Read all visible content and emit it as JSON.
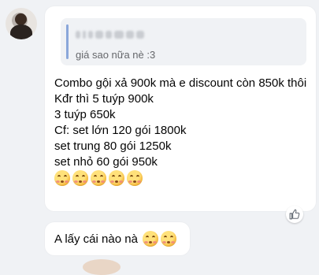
{
  "quote": {
    "text": "giá sao nữa nè :3"
  },
  "message": {
    "lines": [
      "Combo gội xả 900k mà e discount còn 850k thôi",
      "Kđr thì 5 tuýp 900k",
      "3 tuýp 650k",
      "Cf:  set lớn 120 gói 1800k",
      "set trung 80 gói 1250k",
      "set nhỏ 60 gói 950k"
    ],
    "emoji_name": "blushing-smile-emoji",
    "emoji_count": 5
  },
  "second_message": {
    "text": "A lấy cái nào nà",
    "emoji_count": 2
  },
  "colors": {
    "background": "#f0f2f5",
    "bubble": "#ffffff",
    "quote_bar": "#8aa7da",
    "quote_text": "#65676b",
    "text": "#050505"
  }
}
